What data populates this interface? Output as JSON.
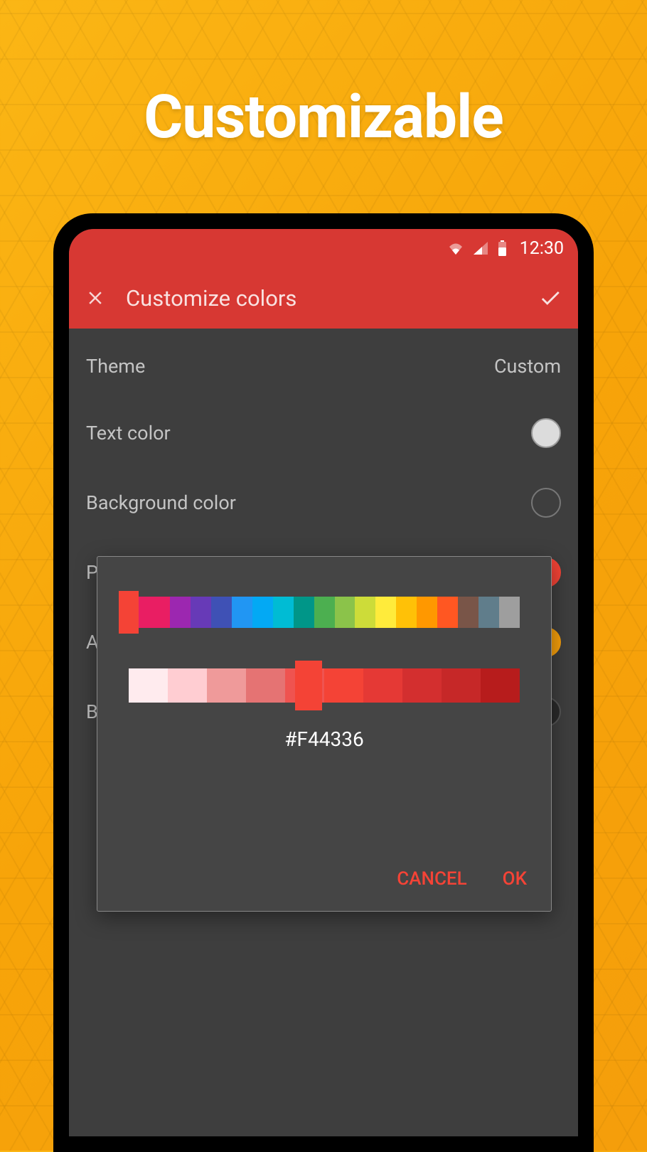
{
  "hero": {
    "title": "Customizable"
  },
  "statusBar": {
    "time": "12:30"
  },
  "appBar": {
    "title": "Customize colors"
  },
  "settings": {
    "theme": {
      "label": "Theme",
      "value": "Custom"
    },
    "textColor": {
      "label": "Text color",
      "color": "#dcdcdc"
    },
    "backgroundColor": {
      "label": "Background color",
      "color": "#3e3e3e"
    },
    "primary": {
      "labelPartial": "Pr",
      "color": "#f44336"
    },
    "accent": {
      "labelPartial": "Ap",
      "color": "#f59e0b"
    },
    "bottom": {
      "labelPartial": "Bo",
      "color": "#2a2a2a"
    }
  },
  "colorPicker": {
    "hexValue": "#F44336",
    "hueColors": [
      "#e91e63",
      "#e91e63",
      "#9c27b0",
      "#673ab7",
      "#3f51b5",
      "#2196f3",
      "#03a9f4",
      "#00bcd4",
      "#009688",
      "#4caf50",
      "#8bc34a",
      "#cddc39",
      "#ffeb3b",
      "#ffc107",
      "#ff9800",
      "#ff5722",
      "#795548",
      "#607d8b",
      "#9e9e9e"
    ],
    "shadeColors": [
      "#ffebee",
      "#ffcdd2",
      "#ef9a9a",
      "#e57373",
      "#ef5350",
      "#f44336",
      "#e53935",
      "#d32f2f",
      "#c62828",
      "#b71c1c"
    ],
    "cancelLabel": "CANCEL",
    "okLabel": "OK"
  }
}
